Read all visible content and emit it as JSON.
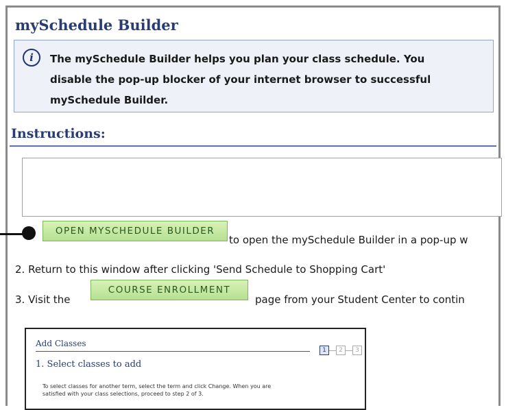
{
  "page": {
    "title": "mySchedule Builder"
  },
  "info": {
    "icon": "info-icon",
    "line1": "The mySchedule Builder helps you plan your class schedule.  You",
    "line2": "disable the pop-up blocker of your internet browser to successful",
    "line3": "mySchedule Builder."
  },
  "instructions": {
    "heading": "Instructions:"
  },
  "steps": {
    "open_button": "OPEN MYSCHEDULE BUILDER",
    "step1_text": "to open the mySchedule Builder in a pop-up w",
    "step2_text": "2. Return to this window after clicking 'Send Schedule to Shopping Cart'",
    "step3_prefix": "3. Visit the",
    "course_button": "COURSE ENROLLMENT",
    "step3_suffix": "page from your Student Center to contin"
  },
  "thumbnail": {
    "heading": "Add Classes",
    "step_labels": [
      "1",
      "2",
      "3"
    ],
    "subheading": "1.  Select classes to add",
    "body_line1": "To select classes for another term, select the term and click Change.  When you are",
    "body_line2": "satisfied with your class selections, proceed to step 2 of 3."
  },
  "colors": {
    "heading_blue": "#2a3d73",
    "info_bg": "#eef1f8",
    "button_green": "#b5e090"
  }
}
